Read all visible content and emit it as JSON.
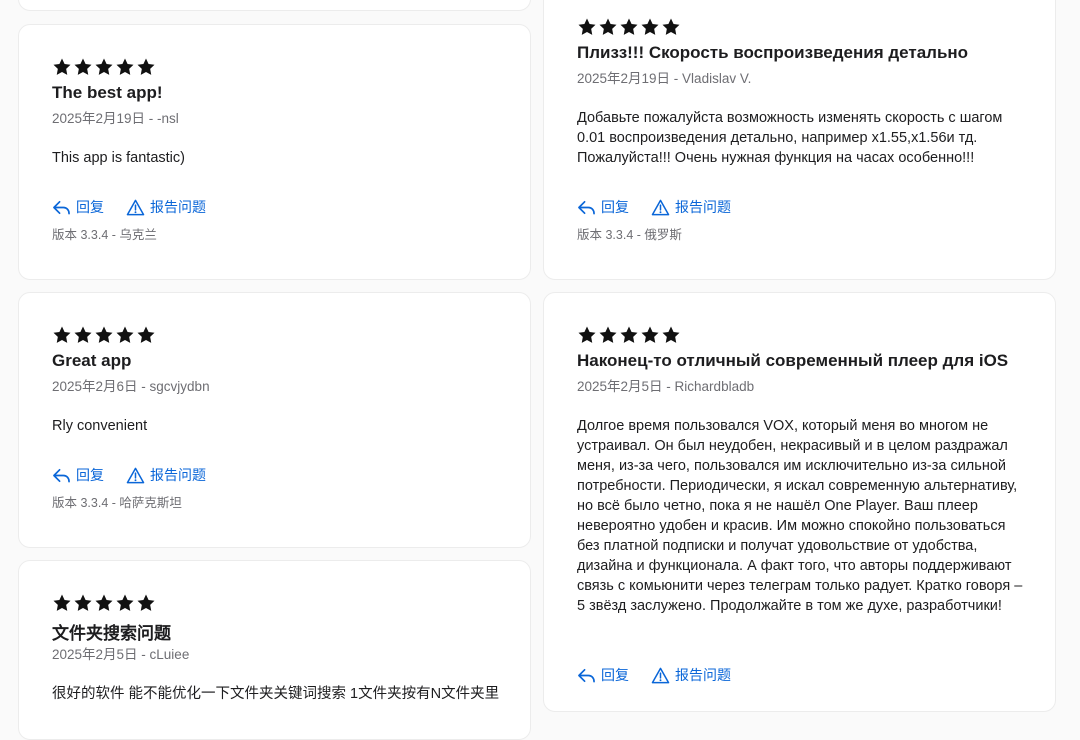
{
  "colors": {
    "accent": "#0a66d8",
    "star": "#111111",
    "muted": "#6e6e73"
  },
  "labels": {
    "reply": "回复",
    "report": "报告问题"
  },
  "icons": {
    "reply": "reply-arrow-icon",
    "report": "warning-triangle-icon",
    "star": "star-icon"
  },
  "reviews": [
    {
      "rating": 5,
      "title": "The best app!",
      "meta": "2025年2月19日 - -nsl",
      "body": "This app is fantastic)",
      "version": "版本 3.3.4 - 乌克兰"
    },
    {
      "rating": 5,
      "title": "Плизз!!! Скорость воспроизведения детально",
      "meta": "2025年2月19日 - Vladislav V.",
      "body": "Добавьте пожалуйста возможность изменять скорость с шагом 0.01 воспроизведения детально, например x1.55,x1.56и тд. Пожалуйста!!! Очень нужная функция на часах особенно!!!",
      "version": "版本 3.3.4 - 俄罗斯"
    },
    {
      "rating": 5,
      "title": "Great app",
      "meta": "2025年2月6日 - sgcvjydbn",
      "body": "Rly convenient",
      "version": "版本 3.3.4 - 哈萨克斯坦"
    },
    {
      "rating": 5,
      "title": "Наконец-то отличный современный плеер для iOS",
      "meta": "2025年2月5日 - Richardbladb",
      "body": "Долгое время пользовался VOX, который меня во многом не устраивал. Он был неудобен, некрасивый и в целом раздражал меня, из-за чего, пользовался им исключительно из-за сильной потребности. Периодически, я искал современную альтернативу, но всё было четно, пока я не нашёл One Player. Ваш плеер невероятно удобен и красив. Им можно спокойно пользоваться без платной подписки и получат удовольствие от удобства, дизайна и функционала. А факт того, что авторы поддерживают связь с комьюнити через телеграм только радует. Кратко говоря – 5 звёзд заслужено. Продолжайте в том же духе, разработчики!"
    },
    {
      "rating": 5,
      "title": "文件夹搜索问题",
      "meta": "2025年2月5日 - cLuiee",
      "body": "很好的软件 能不能优化一下文件夹关键词搜索 1文件夹按有N文件夹里"
    }
  ]
}
